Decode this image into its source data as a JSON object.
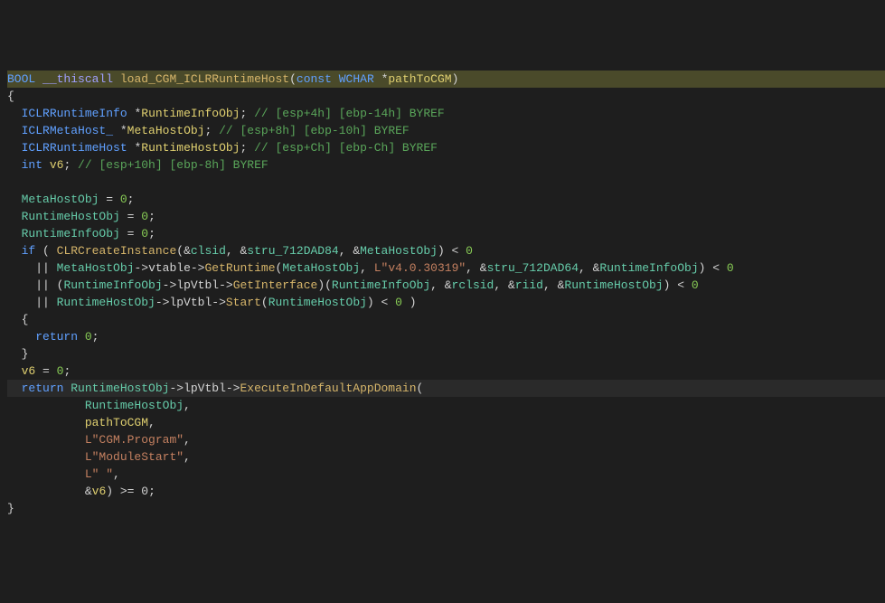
{
  "sig": {
    "ret": "BOOL",
    "cc": "__thiscall",
    "name": "load_CGM_ICLRRuntimeHost",
    "p_kw": "const",
    "p_type": "WCHAR",
    "p_ptr": "*",
    "p_name": "pathToCGM"
  },
  "decl": {
    "t1": "ICLRRuntimeInfo",
    "n1": "RuntimeInfoObj",
    "c1": "// [esp+4h] [ebp-14h] BYREF",
    "t2": "ICLRMetaHost_",
    "n2": "MetaHostObj",
    "c2": "// [esp+8h] [ebp-10h] BYREF",
    "t3": "ICLRRuntimeHost",
    "n3": "RuntimeHostObj",
    "c3": "// [esp+Ch] [ebp-Ch] BYREF",
    "t4": "int",
    "n4": "v6",
    "c4": "// [esp+10h] [ebp-8h] BYREF"
  },
  "body": {
    "z": "0",
    "if": "if",
    "ret": "return",
    "cci": "CLRCreateInstance",
    "clsid": "clsid",
    "stru1": "stru_712DAD84",
    "stru2": "stru_712DAD64",
    "vtable": "vtable",
    "lpvtbl": "lpVtbl",
    "getruntime": "GetRuntime",
    "getinterface": "GetInterface",
    "start": "Start",
    "exec": "ExecuteInDefaultAppDomain",
    "rclsid": "rclsid",
    "riid": "riid",
    "lver": "L\"v4.0.30319\"",
    "lprog": "L\"CGM.Program\"",
    "lmod": "L\"ModuleStart\"",
    "lsp": "L\" \"",
    "ge0": ">= 0"
  }
}
